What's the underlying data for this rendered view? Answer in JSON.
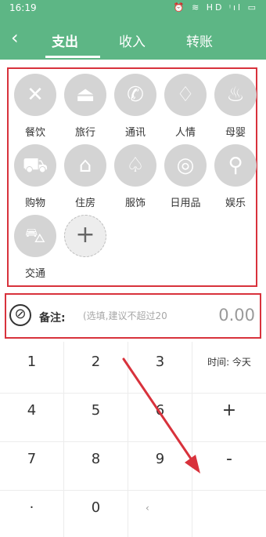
{
  "status": {
    "time": "16:19",
    "icons": "⏰ ≋ HD ᵎıl ▭"
  },
  "header": {
    "tabs": [
      "支出",
      "收入",
      "转账"
    ]
  },
  "categories": [
    {
      "label": "餐饮",
      "icon": "✕"
    },
    {
      "label": "旅行",
      "icon": "⏏"
    },
    {
      "label": "通讯",
      "icon": "✆"
    },
    {
      "label": "人情",
      "icon": "♢"
    },
    {
      "label": "母婴",
      "icon": "♨"
    },
    {
      "label": "购物",
      "icon": "⛟"
    },
    {
      "label": "住房",
      "icon": "⌂"
    },
    {
      "label": "服饰",
      "icon": "♤"
    },
    {
      "label": "日用品",
      "icon": "◎"
    },
    {
      "label": "娱乐",
      "icon": "⚲"
    },
    {
      "label": "交通",
      "icon": "⛍"
    }
  ],
  "add_icon": "+",
  "note": {
    "icon": "⊘",
    "label": "备注:",
    "placeholder": "(选填,建议不超过20",
    "amount": "0.00"
  },
  "keypad": [
    [
      "1",
      "2",
      "3",
      "时间: 今天"
    ],
    [
      "4",
      "5",
      "6",
      "+"
    ],
    [
      "7",
      "8",
      "9",
      "-"
    ],
    [
      "·",
      "0",
      "‹",
      ""
    ]
  ]
}
